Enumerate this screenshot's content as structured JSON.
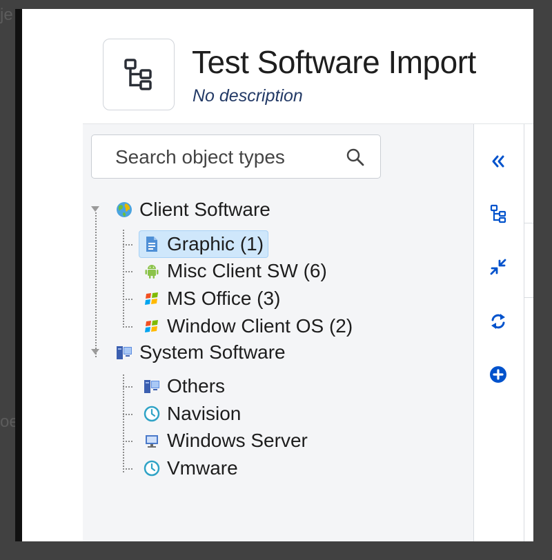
{
  "background": {
    "top_text": "je                                                                             u",
    "left_text": "oe"
  },
  "header": {
    "title": "Test Software Import",
    "description": "No description",
    "icon": "hierarchy-icon"
  },
  "search": {
    "placeholder": "Search object types",
    "icon": "search-icon"
  },
  "tree": {
    "groups": [
      {
        "label": "Client Software",
        "icon": "globe-icon",
        "expanded": true,
        "children": [
          {
            "label": "Graphic (1)",
            "icon": "document-icon",
            "selected": true
          },
          {
            "label": "Misc Client SW (6)",
            "icon": "android-icon"
          },
          {
            "label": "MS Office (3)",
            "icon": "windows-flag-icon"
          },
          {
            "label": "Window Client OS (2)",
            "icon": "windows-flag-icon"
          }
        ]
      },
      {
        "label": "System Software",
        "icon": "computer-icon",
        "expanded": true,
        "children": [
          {
            "label": "Others",
            "icon": "computer-icon"
          },
          {
            "label": "Navision",
            "icon": "clock-icon"
          },
          {
            "label": "Windows Server",
            "icon": "monitor-icon"
          },
          {
            "label": "Vmware",
            "icon": "clock-icon"
          }
        ]
      }
    ]
  },
  "toolbar": {
    "buttons": [
      "collapse-panel-icon",
      "hierarchy-icon",
      "compress-icon",
      "refresh-icon",
      "add-circle-icon"
    ],
    "accent": "#0052cc"
  }
}
